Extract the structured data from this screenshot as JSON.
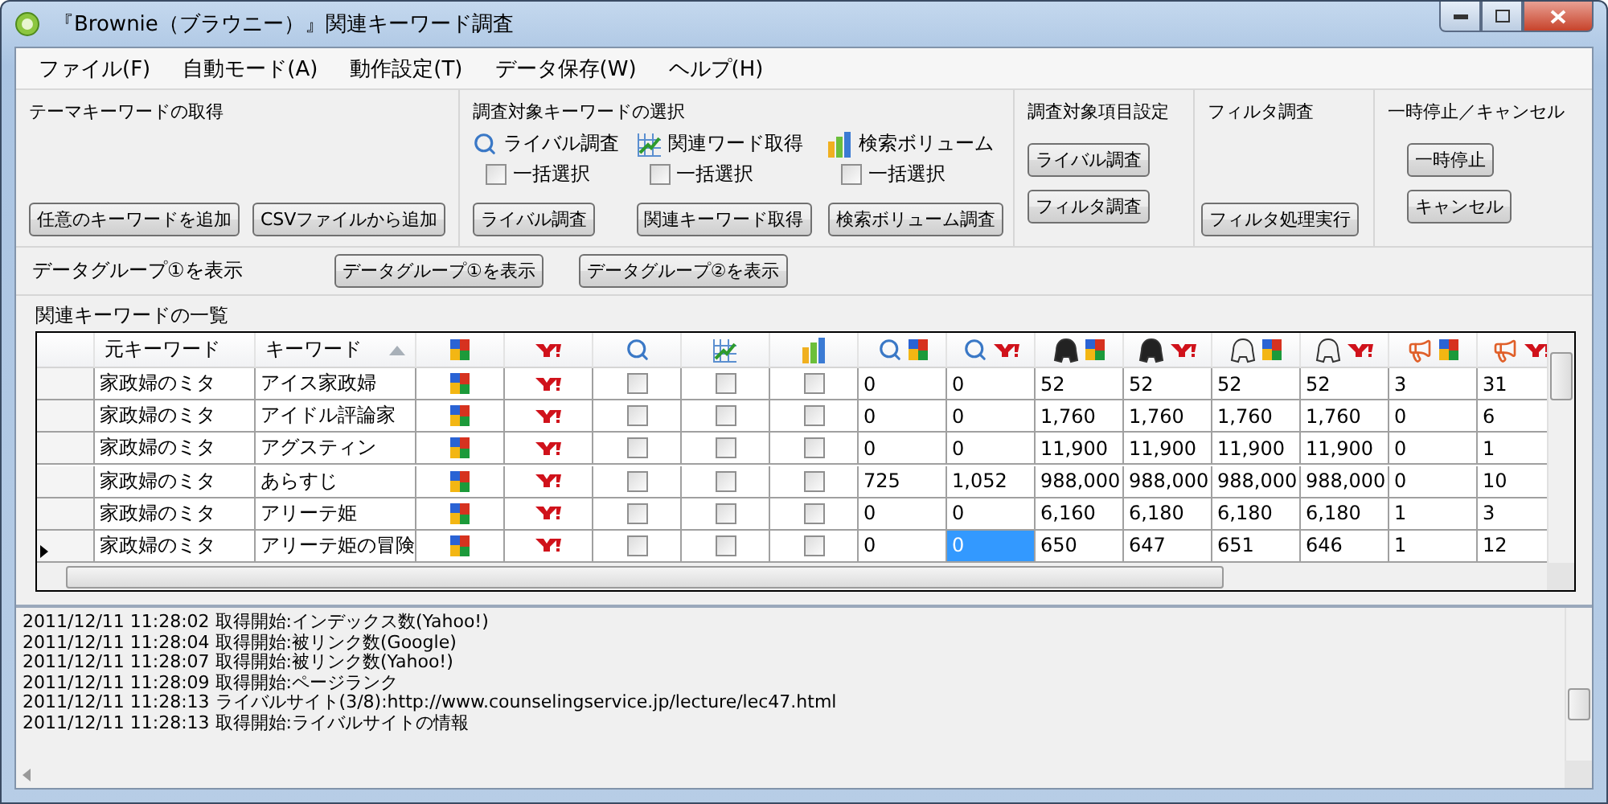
{
  "window": {
    "title": "『Brownie（ブラウニー）』関連キーワード調査"
  },
  "menu": [
    "ファイル(F)",
    "自動モード(A)",
    "動作設定(T)",
    "データ保存(W)",
    "ヘルプ(H)"
  ],
  "theme_group": {
    "title": "テーマキーワードの取得",
    "buttons": [
      "任意のキーワードを追加",
      "CSVファイルから追加"
    ]
  },
  "target_group": {
    "title": "調査対象キーワードの選択",
    "items": [
      {
        "label": "ライバル調査",
        "select_all": {
          "label": "一括選択",
          "checked": false
        },
        "button": "ライバル調査"
      },
      {
        "label": "関連ワード取得",
        "select_all": {
          "label": "一括選択",
          "checked": false
        },
        "button": "関連キーワード取得"
      },
      {
        "label": "検索ボリューム",
        "select_all": {
          "label": "一括選択",
          "checked": false
        },
        "button": "検索ボリューム調査"
      }
    ]
  },
  "settings_group": {
    "title": "調査対象項目設定",
    "buttons": [
      "ライバル調査",
      "フィルタ調査"
    ]
  },
  "filter_group": {
    "title": "フィルタ調査",
    "buttons": [
      "フィルタ処理実行"
    ]
  },
  "pause_group": {
    "title": "一時停止／キャンセル",
    "buttons": [
      "一時停止",
      "キャンセル"
    ]
  },
  "data_group": {
    "label": "データグループ①を表示",
    "buttons": [
      "データグループ①を表示",
      "データグループ②を表示"
    ]
  },
  "table": {
    "title": "関連キーワードの一覧",
    "columns": [
      {
        "label": "元キーワード",
        "sorted": false
      },
      {
        "label": "キーワード",
        "sorted": true
      }
    ],
    "rows": [
      {
        "current": false,
        "origin": "家政婦のミタ",
        "keyword": "アイス家政婦",
        "checks": [
          {
            "checked": false
          },
          {
            "checked": false
          },
          {
            "checked": false
          }
        ],
        "numbers": [
          {
            "text": "0",
            "selected": false
          },
          {
            "text": "0",
            "selected": false
          },
          {
            "text": "52",
            "selected": false
          },
          {
            "text": "52",
            "selected": false
          },
          {
            "text": "52",
            "selected": false
          },
          {
            "text": "52",
            "selected": false
          },
          {
            "text": "3",
            "selected": false
          },
          {
            "text": "31",
            "selected": false
          }
        ]
      },
      {
        "current": false,
        "origin": "家政婦のミタ",
        "keyword": "アイドル評論家",
        "checks": [
          {
            "checked": false
          },
          {
            "checked": false
          },
          {
            "checked": false
          }
        ],
        "numbers": [
          {
            "text": "0",
            "selected": false
          },
          {
            "text": "0",
            "selected": false
          },
          {
            "text": "1,760",
            "selected": false
          },
          {
            "text": "1,760",
            "selected": false
          },
          {
            "text": "1,760",
            "selected": false
          },
          {
            "text": "1,760",
            "selected": false
          },
          {
            "text": "0",
            "selected": false
          },
          {
            "text": "6",
            "selected": false
          }
        ]
      },
      {
        "current": false,
        "origin": "家政婦のミタ",
        "keyword": "アグスティン",
        "checks": [
          {
            "checked": false
          },
          {
            "checked": false
          },
          {
            "checked": false
          }
        ],
        "numbers": [
          {
            "text": "0",
            "selected": false
          },
          {
            "text": "0",
            "selected": false
          },
          {
            "text": "11,900",
            "selected": false
          },
          {
            "text": "11,900",
            "selected": false
          },
          {
            "text": "11,900",
            "selected": false
          },
          {
            "text": "11,900",
            "selected": false
          },
          {
            "text": "0",
            "selected": false
          },
          {
            "text": "1",
            "selected": false
          }
        ]
      },
      {
        "current": false,
        "origin": "家政婦のミタ",
        "keyword": "あらすじ",
        "checks": [
          {
            "checked": false
          },
          {
            "checked": false
          },
          {
            "checked": false
          }
        ],
        "numbers": [
          {
            "text": "725",
            "selected": false
          },
          {
            "text": "1,052",
            "selected": false
          },
          {
            "text": "988,000",
            "selected": false
          },
          {
            "text": "988,000",
            "selected": false
          },
          {
            "text": "988,000",
            "selected": false
          },
          {
            "text": "988,000",
            "selected": false
          },
          {
            "text": "0",
            "selected": false
          },
          {
            "text": "10",
            "selected": false
          }
        ]
      },
      {
        "current": false,
        "origin": "家政婦のミタ",
        "keyword": "アリーテ姫",
        "checks": [
          {
            "checked": false
          },
          {
            "checked": false
          },
          {
            "checked": false
          }
        ],
        "numbers": [
          {
            "text": "0",
            "selected": false
          },
          {
            "text": "0",
            "selected": false
          },
          {
            "text": "6,160",
            "selected": false
          },
          {
            "text": "6,180",
            "selected": false
          },
          {
            "text": "6,180",
            "selected": false
          },
          {
            "text": "6,180",
            "selected": false
          },
          {
            "text": "1",
            "selected": false
          },
          {
            "text": "3",
            "selected": false
          }
        ]
      },
      {
        "current": true,
        "origin": "家政婦のミタ",
        "keyword": "アリーテ姫の冒険",
        "checks": [
          {
            "checked": false
          },
          {
            "checked": false
          },
          {
            "checked": false
          }
        ],
        "numbers": [
          {
            "text": "0",
            "selected": false
          },
          {
            "text": "0",
            "selected": true
          },
          {
            "text": "650",
            "selected": false
          },
          {
            "text": "647",
            "selected": false
          },
          {
            "text": "651",
            "selected": false
          },
          {
            "text": "646",
            "selected": false
          },
          {
            "text": "1",
            "selected": false
          },
          {
            "text": "12",
            "selected": false
          }
        ]
      }
    ]
  },
  "log": [
    "2011/12/11 11:28:02 取得開始:インデックス数(Yahoo!)",
    "2011/12/11 11:28:04 取得開始:被リンク数(Google)",
    "2011/12/11 11:28:07 取得開始:被リンク数(Yahoo!)",
    "2011/12/11 11:28:09 取得開始:ページランク",
    "2011/12/11 11:28:13 ライバルサイト(3/8):http://www.counselingservice.jp/lecture/lec47.html",
    "2011/12/11 11:28:13 取得開始:ライバルサイトの情報"
  ]
}
